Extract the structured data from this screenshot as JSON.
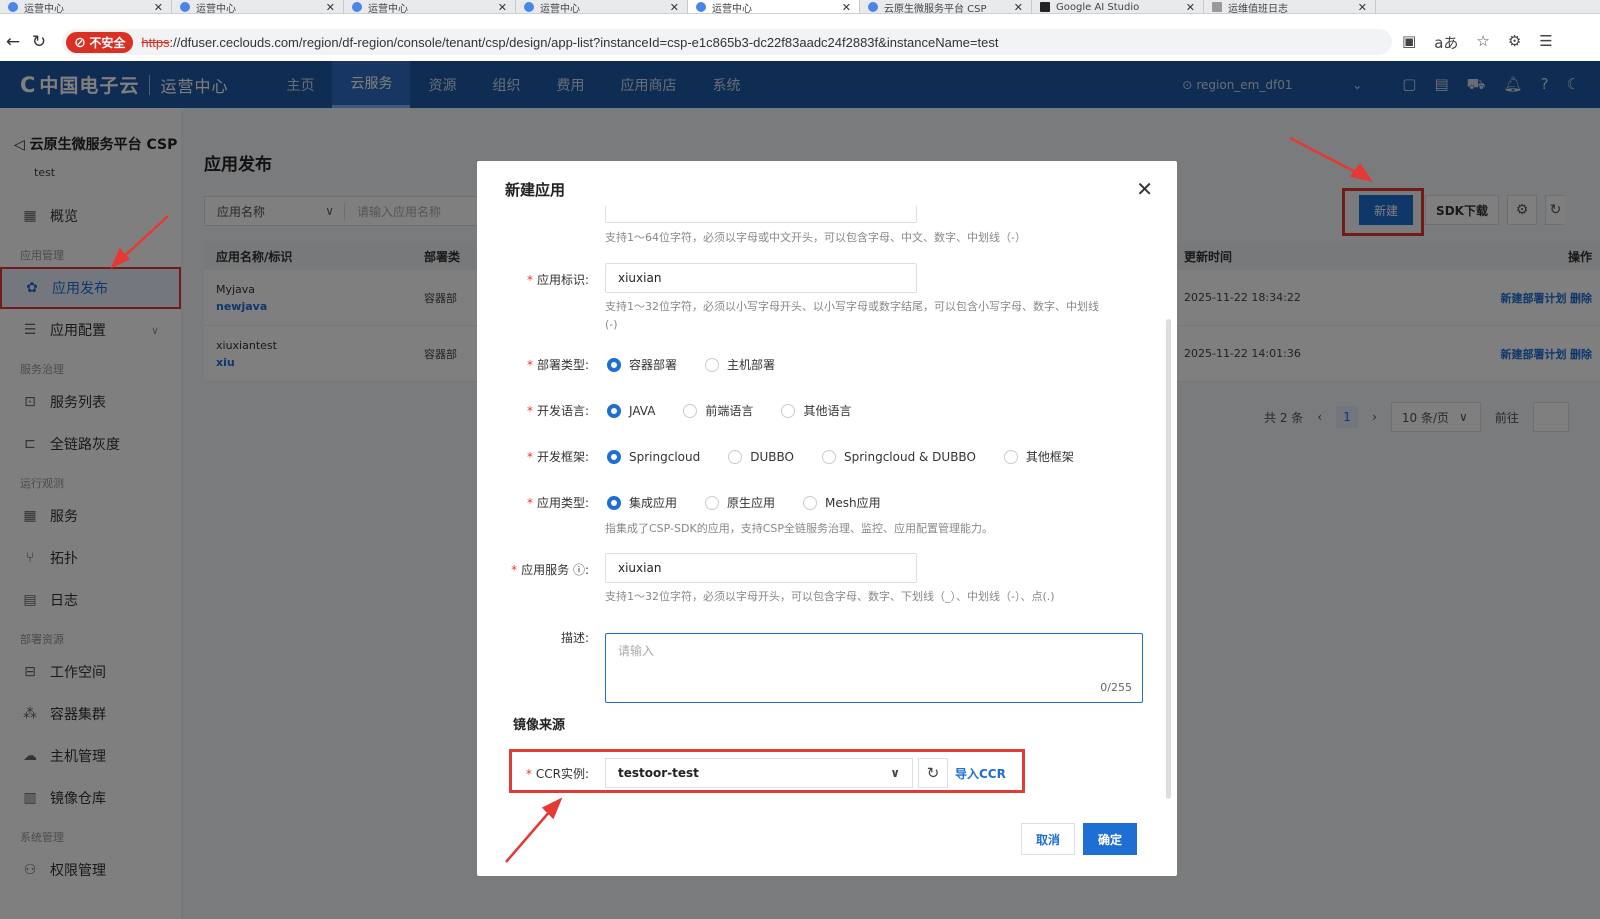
{
  "browser": {
    "tabs": [
      {
        "label": "运营中心"
      },
      {
        "label": "运营中心"
      },
      {
        "label": "运营中心"
      },
      {
        "label": "运营中心"
      },
      {
        "label": "运营中心",
        "active": true
      },
      {
        "label": "云原生微服务平台 CSP"
      },
      {
        "label": "Google AI Studio"
      },
      {
        "label": "运维值班日志"
      }
    ],
    "insecure_label": "不安全",
    "url_scheme": "https",
    "url_rest": "://dfuser.ceclouds.com/region/df-region/console/tenant/csp/design/app-list?instanceId=csp-e1c865b3-dc22f83aadc24f2883f&instanceName=test"
  },
  "header": {
    "logo_text": "中国电子云",
    "logo_sub": "运营中心",
    "menu": [
      "主页",
      "云服务",
      "资源",
      "组织",
      "费用",
      "应用商店",
      "系统"
    ],
    "active_menu": "云服务",
    "region": "region_em_df01"
  },
  "sidebar": {
    "title": "云原生微服务平台 CSP",
    "subtitle": "test",
    "overview": "概览",
    "group_app": "应用管理",
    "app_publish": "应用发布",
    "app_config": "应用配置",
    "group_service": "服务治理",
    "service_list": "服务列表",
    "full_link_gray": "全链路灰度",
    "group_ops": "运行观测",
    "services": "服务",
    "topology": "拓扑",
    "logs": "日志",
    "group_deploy": "部署资源",
    "workspace": "工作空间",
    "container_cluster": "容器集群",
    "host_mgmt": "主机管理",
    "image_repo": "镜像仓库",
    "group_system": "系统管理",
    "permission": "权限管理"
  },
  "main": {
    "title": "应用发布",
    "filter_select": "应用名称",
    "filter_placeholder": "请输入应用名称",
    "btn_new": "新建",
    "btn_sdk": "SDK下载",
    "columns": {
      "name": "应用名称/标识",
      "deploy": "部署类",
      "updated": "更新时间",
      "ops": "操作"
    },
    "rows": [
      {
        "name": "Myjava",
        "id": "newjava",
        "deploy": "容器部",
        "updated": "2025-11-22 18:34:22",
        "plan": "新建部署计划",
        "del": "删除"
      },
      {
        "name": "xiuxiantest",
        "id": "xiu",
        "deploy": "容器部",
        "updated": "2025-11-22 14:01:36",
        "plan": "新建部署计划",
        "del": "删除"
      }
    ],
    "pager": {
      "total": "共 2 条",
      "page": "1",
      "size": "10 条/页",
      "goto": "前往"
    }
  },
  "modal": {
    "title": "新建应用",
    "name_help": "支持1～64位字符，必须以字母或中文开头，可以包含字母、中文、数字、中划线（-）",
    "id_label": "应用标识:",
    "id_value": "xiuxian",
    "id_help_1": "支持1～32位字符，必须以小写字母开头、以小写字母或数字结尾，可以包含小写字母、数字、中划线",
    "id_help_2": "(-)",
    "deploy_label": "部署类型:",
    "deploy_options": [
      "容器部署",
      "主机部署"
    ],
    "lang_label": "开发语言:",
    "lang_options": [
      "JAVA",
      "前端语言",
      "其他语言"
    ],
    "framework_label": "开发框架:",
    "framework_options": [
      "Springcloud",
      "DUBBO",
      "Springcloud & DUBBO",
      "其他框架"
    ],
    "type_label": "应用类型:",
    "type_options": [
      "集成应用",
      "原生应用",
      "Mesh应用"
    ],
    "type_help": "指集成了CSP-SDK的应用，支持CSP全链服务治理、监控、应用配置管理能力。",
    "service_label": "应用服务",
    "service_value": "xiuxian",
    "service_help": "支持1～32位字符，必须以字母开头，可以包含字母、数字、下划线（_）、中划线（-）、点(.)",
    "desc_label": "描述:",
    "desc_placeholder": "请输入",
    "desc_counter": "0/255",
    "image_source_title": "镜像来源",
    "ccr_label": "CCR实例:",
    "ccr_value": "testoor-test",
    "ccr_import": "导入CCR",
    "btn_cancel": "取消",
    "btn_ok": "确定"
  },
  "colors": {
    "primary": "#1f6ed4",
    "header": "#1f5aa6",
    "annotation": "#e53935"
  }
}
